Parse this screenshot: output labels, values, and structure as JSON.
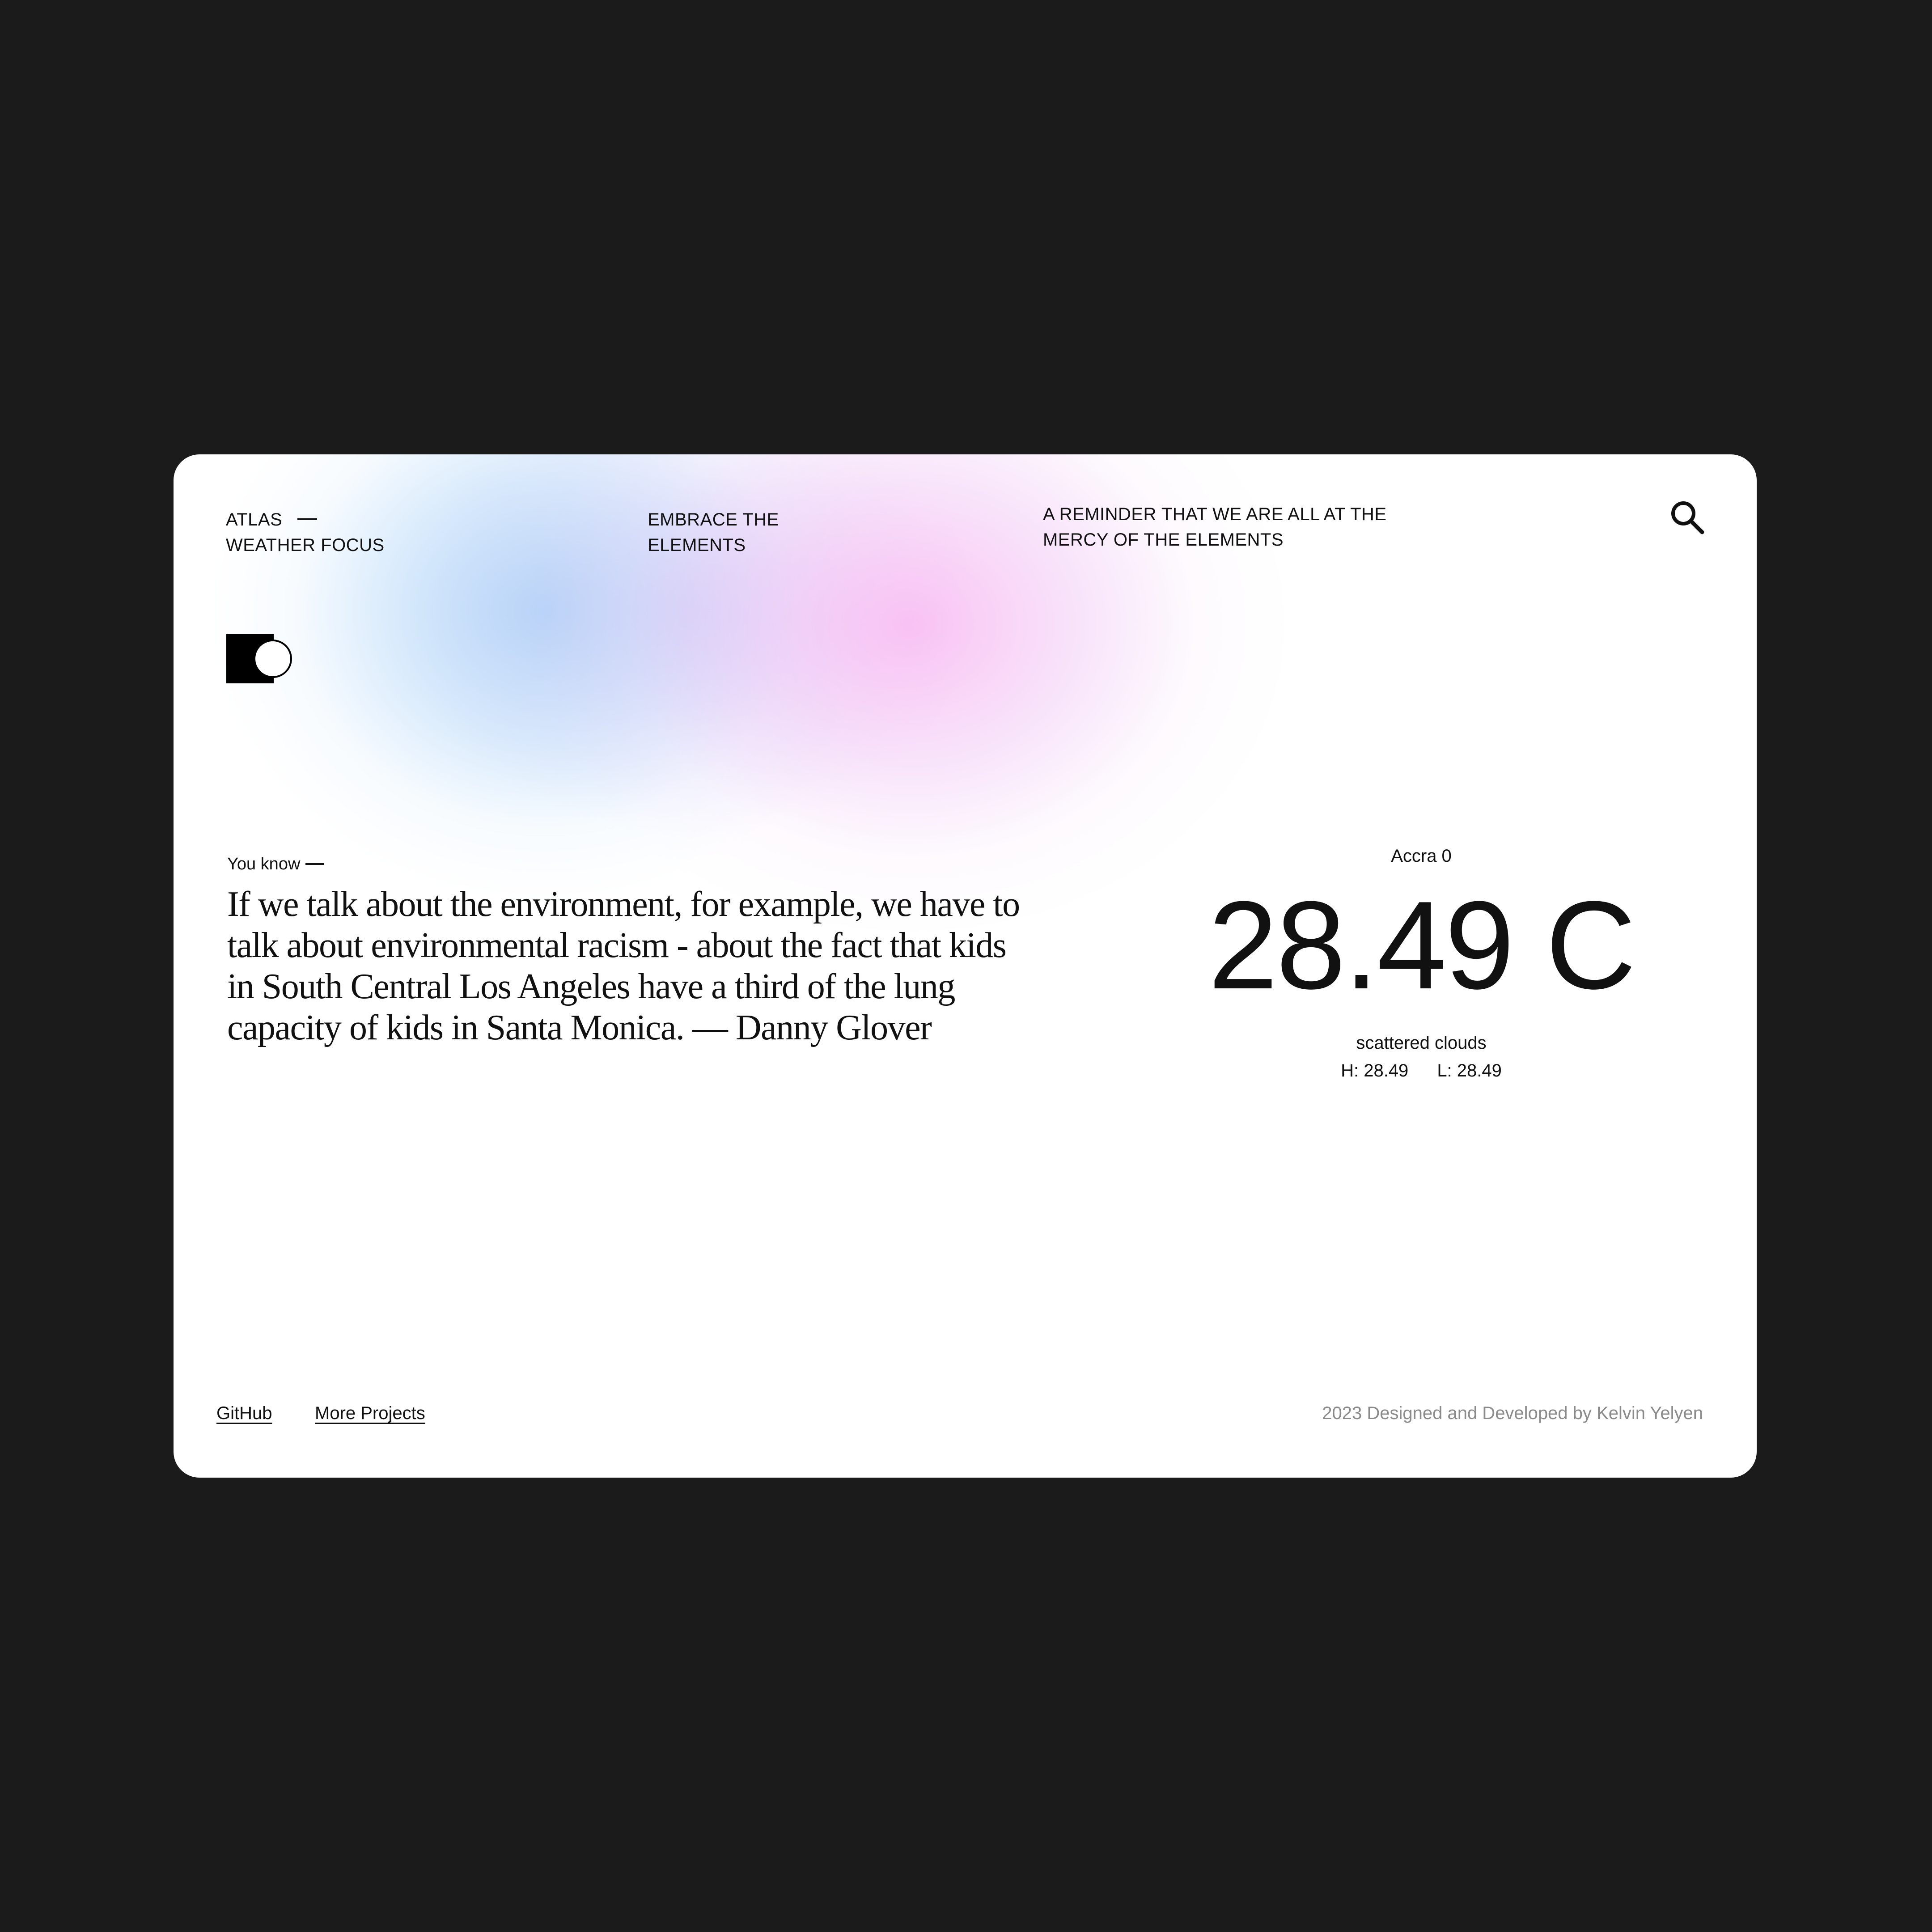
{
  "brand": {
    "line1": "ATLAS",
    "line2": "WEATHER FOCUS"
  },
  "tagline": {
    "line1": "EMBRACE THE",
    "line2": "ELEMENTS"
  },
  "reminder": {
    "line1": "A REMINDER THAT WE ARE ALL AT THE",
    "line2": "MERCY OF THE ELEMENTS"
  },
  "icons": {
    "search": "search-icon",
    "logo": "half-moon-logo-icon"
  },
  "quote": {
    "intro": "You know",
    "text": "If we talk about the environment, for example, we have to talk about environmental racism - about the fact that kids in South Central Los Angeles have a third of the lung capacity of kids in Santa Monica. — Danny Glover"
  },
  "weather": {
    "city": "Accra 0",
    "temperature": "28.49 C",
    "description": "scattered clouds",
    "high": "H: 28.49",
    "low": "L: 28.49"
  },
  "footer": {
    "github": "GitHub",
    "more_projects": "More Projects",
    "credit": "2023 Designed and Developed by Kelvin Yelyen"
  },
  "colors": {
    "page_background": "#1b1b1b",
    "card_background": "#ffffff",
    "text": "#111111",
    "credit_text": "#8a8a8a",
    "glow_blue": "#96c8f5",
    "glow_pink": "#f8aff0"
  }
}
